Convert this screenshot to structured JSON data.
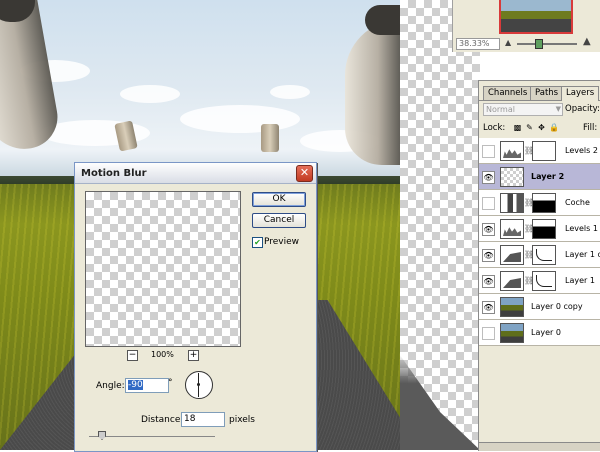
{
  "navigator": {
    "zoom": "38.33%"
  },
  "layers_panel": {
    "tabs": [
      "Channels",
      "Paths",
      "Layers"
    ],
    "active_tab": "Layers",
    "blend_mode": "Normal",
    "opacity_label": "Opacity:",
    "lock_label": "Lock:",
    "fill_label": "Fill:",
    "layers": [
      {
        "name": "Levels 2",
        "visible": false,
        "selected": false
      },
      {
        "name": "Layer 2",
        "visible": true,
        "selected": true
      },
      {
        "name": "Coche",
        "visible": false,
        "selected": false
      },
      {
        "name": "Levels 1",
        "visible": true,
        "selected": false
      },
      {
        "name": "Layer 1 c...",
        "visible": true,
        "selected": false
      },
      {
        "name": "Layer 1",
        "visible": true,
        "selected": false
      },
      {
        "name": "Layer 0 copy",
        "visible": true,
        "selected": false
      },
      {
        "name": "Layer 0",
        "visible": false,
        "selected": false
      }
    ]
  },
  "dialog": {
    "title": "Motion Blur",
    "ok_label": "OK",
    "cancel_label": "Cancel",
    "preview_label": "Preview",
    "preview_checked": true,
    "zoom_value": "100%",
    "angle_label": "Angle:",
    "angle_value": "-90",
    "degree_symbol": "°",
    "distance_label": "Distance:",
    "distance_value": "18",
    "distance_unit": "pixels"
  },
  "icons": {
    "close": "close-icon",
    "eye": "eye-icon",
    "chain": "link-icon",
    "zoom_in": "zoom-in-icon",
    "zoom_out": "zoom-out-icon"
  }
}
